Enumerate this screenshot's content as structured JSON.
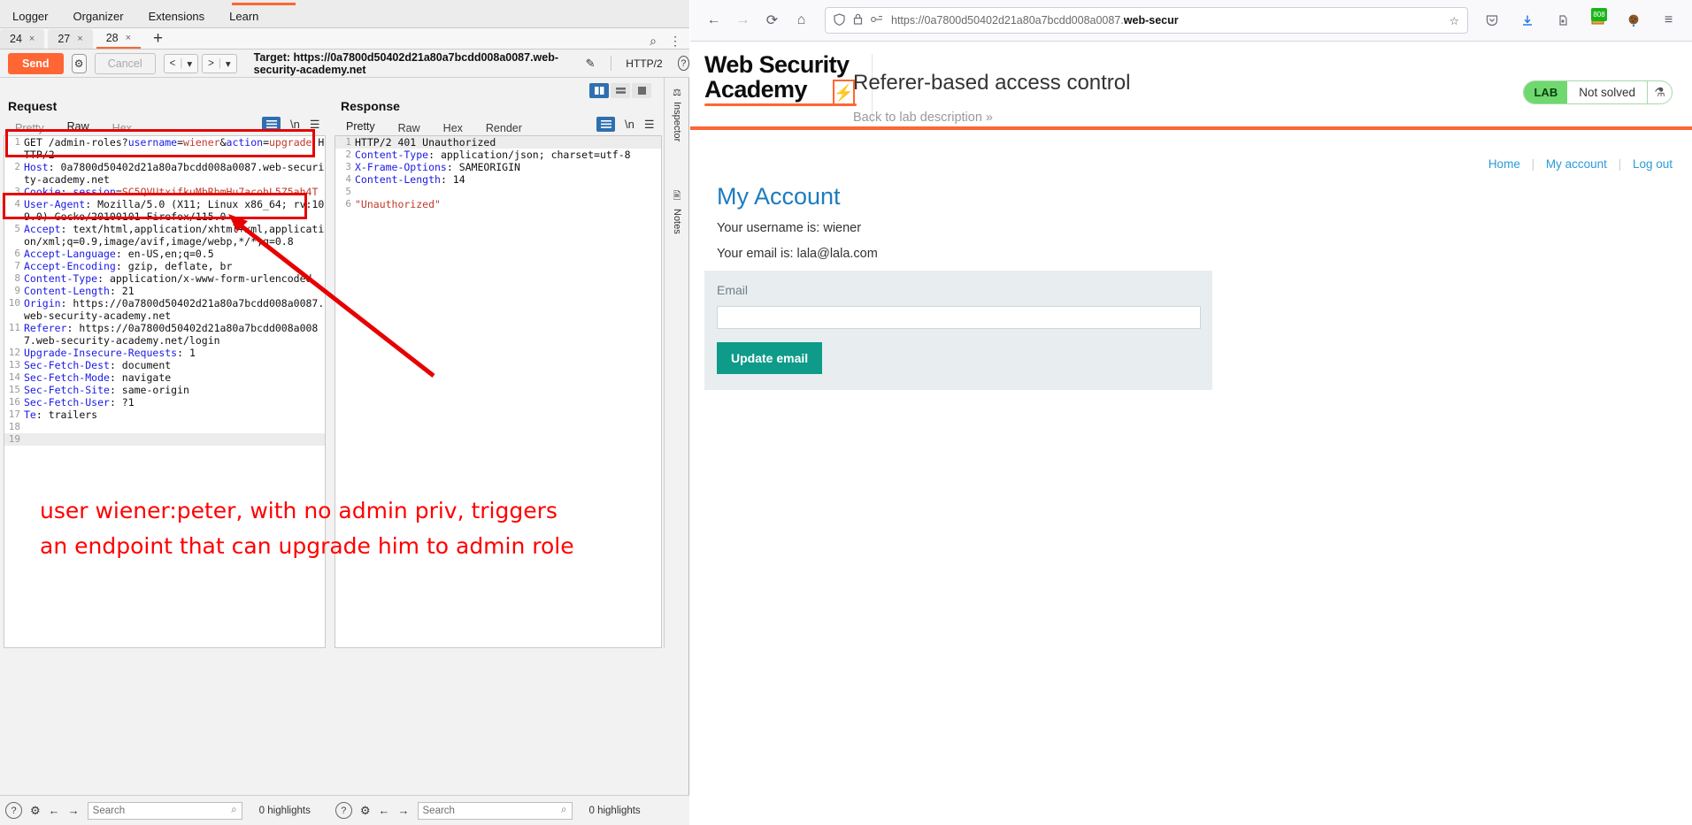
{
  "burp": {
    "menu": [
      "Logger",
      "Organizer",
      "Extensions",
      "Learn"
    ],
    "tabs": [
      {
        "label": "24",
        "close": "×",
        "active": false
      },
      {
        "label": "27",
        "close": "×",
        "active": false
      },
      {
        "label": "28",
        "close": "×",
        "active": true
      }
    ],
    "new_tab": "+",
    "toolbar": {
      "send": "Send",
      "settings_icon": "⚙",
      "cancel": "Cancel",
      "prev": "<",
      "prev_caret": "▾",
      "next": ">",
      "next_caret": "▾",
      "target": "Target: https://0a7800d50402d21a80a7bcdd008a0087.web-security-academy.net",
      "edit_icon": "✎",
      "protocol": "HTTP/2",
      "help_icon": "?",
      "search_icon": "⌕",
      "more_icon": "⋮"
    },
    "request": {
      "title": "Request",
      "subtabs": [
        "Pretty",
        "Raw",
        "Hex"
      ],
      "active_subtab": "Raw",
      "lines": [
        {
          "n": "1",
          "segs": [
            {
              "t": "GET /admin-roles?",
              "c": "plain"
            },
            {
              "t": "username",
              "c": "v-blu"
            },
            {
              "t": "=",
              "c": "plain"
            },
            {
              "t": "wiener",
              "c": "v-red"
            },
            {
              "t": "&",
              "c": "plain"
            },
            {
              "t": "action",
              "c": "v-blu"
            },
            {
              "t": "=",
              "c": "plain"
            },
            {
              "t": "upgrade",
              "c": "v-red"
            },
            {
              "t": " HTTP/2",
              "c": "plain"
            }
          ]
        },
        {
          "n": "2",
          "segs": [
            {
              "t": "Host",
              "c": "k"
            },
            {
              "t": ": 0a7800d50402d21a80a7bcdd008a0087.web-security-academy.net",
              "c": "plain"
            }
          ]
        },
        {
          "n": "3",
          "segs": [
            {
              "t": "Cookie",
              "c": "k"
            },
            {
              "t": ": ",
              "c": "plain"
            },
            {
              "t": "session",
              "c": "v-blu"
            },
            {
              "t": "=",
              "c": "plain"
            },
            {
              "t": "SC5QVUtxifkuMbRbmHu7acohL5Z5ah4T",
              "c": "v-red"
            }
          ]
        },
        {
          "n": "4",
          "segs": [
            {
              "t": "User-Agent",
              "c": "k"
            },
            {
              "t": ": Mozilla/5.0 (X11; Linux x86_64; rv:109.0) Gecko/20100101 Firefox/115.0",
              "c": "plain"
            }
          ]
        },
        {
          "n": "5",
          "segs": [
            {
              "t": "Accept",
              "c": "k"
            },
            {
              "t": ": text/html,application/xhtml+xml,application/xml;q=0.9,image/avif,image/webp,*/*;q=0.8",
              "c": "plain"
            }
          ]
        },
        {
          "n": "6",
          "segs": [
            {
              "t": "Accept-Language",
              "c": "k"
            },
            {
              "t": ": en-US,en;q=0.5",
              "c": "plain"
            }
          ]
        },
        {
          "n": "7",
          "segs": [
            {
              "t": "Accept-Encoding",
              "c": "k"
            },
            {
              "t": ": gzip, deflate, br",
              "c": "plain"
            }
          ]
        },
        {
          "n": "8",
          "segs": [
            {
              "t": "Content-Type",
              "c": "k"
            },
            {
              "t": ": application/x-www-form-urlencoded",
              "c": "plain"
            }
          ]
        },
        {
          "n": "9",
          "segs": [
            {
              "t": "Content-Length",
              "c": "k"
            },
            {
              "t": ": 21",
              "c": "plain"
            }
          ]
        },
        {
          "n": "10",
          "segs": [
            {
              "t": "Origin",
              "c": "k"
            },
            {
              "t": ": https://0a7800d50402d21a80a7bcdd008a0087.web-security-academy.net",
              "c": "plain"
            }
          ]
        },
        {
          "n": "11",
          "segs": [
            {
              "t": "Referer",
              "c": "k"
            },
            {
              "t": ": https://0a7800d50402d21a80a7bcdd008a0087.web-security-academy.net/login",
              "c": "plain"
            }
          ]
        },
        {
          "n": "12",
          "segs": [
            {
              "t": "Upgrade-Insecure-Requests",
              "c": "k"
            },
            {
              "t": ": 1",
              "c": "plain"
            }
          ]
        },
        {
          "n": "13",
          "segs": [
            {
              "t": "Sec-Fetch-Dest",
              "c": "k"
            },
            {
              "t": ": document",
              "c": "plain"
            }
          ]
        },
        {
          "n": "14",
          "segs": [
            {
              "t": "Sec-Fetch-Mode",
              "c": "k"
            },
            {
              "t": ": navigate",
              "c": "plain"
            }
          ]
        },
        {
          "n": "15",
          "segs": [
            {
              "t": "Sec-Fetch-Site",
              "c": "k"
            },
            {
              "t": ": same-origin",
              "c": "plain"
            }
          ]
        },
        {
          "n": "16",
          "segs": [
            {
              "t": "Sec-Fetch-User",
              "c": "k"
            },
            {
              "t": ": ?1",
              "c": "plain"
            }
          ]
        },
        {
          "n": "17",
          "segs": [
            {
              "t": "Te",
              "c": "k"
            },
            {
              "t": ": trailers",
              "c": "plain"
            }
          ]
        },
        {
          "n": "18",
          "segs": [
            {
              "t": "",
              "c": "plain"
            }
          ]
        },
        {
          "n": "19",
          "segs": [
            {
              "t": "",
              "c": "plain"
            }
          ],
          "hl": true
        }
      ],
      "search_placeholder": "Search",
      "highlights": "0 highlights"
    },
    "response": {
      "title": "Response",
      "subtabs": [
        "Pretty",
        "Raw",
        "Hex",
        "Render"
      ],
      "active_subtab": "Pretty",
      "lines": [
        {
          "n": "1",
          "segs": [
            {
              "t": "HTTP/2 401 Unauthorized",
              "c": "plain"
            }
          ],
          "hl": true
        },
        {
          "n": "2",
          "segs": [
            {
              "t": "Content-Type",
              "c": "k"
            },
            {
              "t": ": application/json; charset=utf-8",
              "c": "plain"
            }
          ]
        },
        {
          "n": "3",
          "segs": [
            {
              "t": "X-Frame-Options",
              "c": "k"
            },
            {
              "t": ": SAMEORIGIN",
              "c": "plain"
            }
          ]
        },
        {
          "n": "4",
          "segs": [
            {
              "t": "Content-Length",
              "c": "k"
            },
            {
              "t": ": 14",
              "c": "plain"
            }
          ]
        },
        {
          "n": "5",
          "segs": [
            {
              "t": "",
              "c": "plain"
            }
          ]
        },
        {
          "n": "6",
          "segs": [
            {
              "t": "\"Unauthorized\"",
              "c": "strg"
            }
          ]
        }
      ],
      "search_placeholder": "Search",
      "highlights": "0 highlights"
    },
    "rail": [
      "Inspector",
      "Notes"
    ],
    "annotation": {
      "line1": "user wiener:peter, with no admin priv, triggers",
      "line2": "an endpoint that can upgrade him to admin role",
      "color": "#ff0000"
    }
  },
  "firefox": {
    "nav": {
      "back": "←",
      "forward": "→",
      "reload": "⟳",
      "home": "⌂",
      "shield_icon": "shield",
      "lock_icon": "⌂",
      "reader_icon": "reader",
      "url_prefix": "https://0a7800d50402d21a80a7bcdd008a0087.",
      "url_bold": "web-secur",
      "bookmark_icon": "☆",
      "pocket_icon": "▽",
      "download_icon": "⤓",
      "account_icon": "⚿",
      "ext_badge": "808",
      "cookie_icon": "●",
      "menu_icon": "≡"
    },
    "lab": {
      "logo_line1": "Web Security",
      "logo_line2": "Academy",
      "logo_zap": "⚡",
      "title": "Referer-based access control",
      "back_link": "Back to lab description »",
      "badge_lab": "LAB",
      "badge_status": "Not solved",
      "badge_icon": "⚗"
    },
    "page": {
      "nav_links": [
        "Home",
        "My account",
        "Log out"
      ],
      "nav_sep": "|",
      "heading": "My Account",
      "username_line": "Your username is: wiener",
      "email_line": "Your email is: lala@lala.com",
      "form_label": "Email",
      "form_value": "",
      "form_placeholder": "",
      "submit": "Update email"
    }
  }
}
